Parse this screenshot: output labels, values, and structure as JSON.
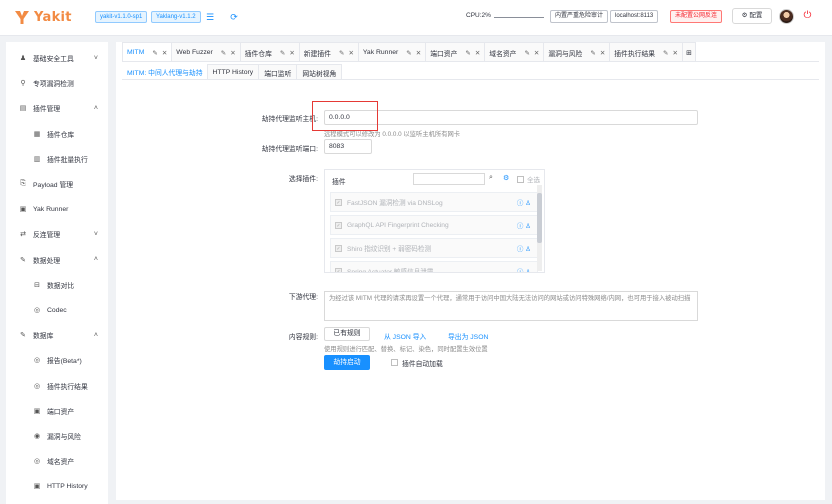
{
  "app": {
    "name": "Yakit",
    "brand_color": "#f28b44",
    "accent": "#1890ff"
  },
  "topbar": {
    "version_tags": [
      "yakit-v1.1.0-sp1",
      "Yaklang-v1.1.2"
    ],
    "icons": [
      "list-icon",
      "refresh-icon"
    ],
    "cpu_label": "CPU:2%",
    "engine_mode": "内置严重危险审计",
    "host": "localhost:8113",
    "warning": "未配置公网反连",
    "settings_label": "配置",
    "power_icon": "power-icon"
  },
  "sidebar": {
    "items": [
      {
        "label": "基础安全工具",
        "icon": "tools-icon",
        "chevron": "⌄",
        "sub": false
      },
      {
        "label": "专项漏洞检测",
        "icon": "scan-icon",
        "chevron": "",
        "sub": false
      },
      {
        "label": "插件管理",
        "icon": "plugin-icon",
        "chevron": "⌃",
        "sub": false
      },
      {
        "label": "插件仓库",
        "icon": "store-icon",
        "chevron": "",
        "sub": true
      },
      {
        "label": "插件批量执行",
        "icon": "batch-icon",
        "chevron": "",
        "sub": true
      },
      {
        "label": "Payload 管理",
        "icon": "payload-icon",
        "chevron": "",
        "sub": false
      },
      {
        "label": "Yak Runner",
        "icon": "runner-icon",
        "chevron": "",
        "sub": false
      },
      {
        "label": "反连管理",
        "icon": "reverse-icon",
        "chevron": "⌄",
        "sub": false
      },
      {
        "label": "数据处理",
        "icon": "data-icon",
        "chevron": "⌃",
        "sub": false
      },
      {
        "label": "数据对比",
        "icon": "compare-icon",
        "chevron": "",
        "sub": true
      },
      {
        "label": "Codec",
        "icon": "codec-icon",
        "chevron": "",
        "sub": true
      },
      {
        "label": "数据库",
        "icon": "database-icon",
        "chevron": "⌃",
        "sub": false
      },
      {
        "label": "报告(Beta*)",
        "icon": "report-icon",
        "chevron": "",
        "sub": true
      },
      {
        "label": "插件执行结果",
        "icon": "result-icon",
        "chevron": "",
        "sub": true
      },
      {
        "label": "端口资产",
        "icon": "port-icon",
        "chevron": "",
        "sub": true
      },
      {
        "label": "漏洞与风险",
        "icon": "risk-icon",
        "chevron": "",
        "sub": true
      },
      {
        "label": "域名资产",
        "icon": "domain-icon",
        "chevron": "",
        "sub": true
      },
      {
        "label": "HTTP History",
        "icon": "history-icon",
        "chevron": "",
        "sub": true
      }
    ]
  },
  "tabs": [
    {
      "label": "MITM",
      "active": true
    },
    {
      "label": "Web Fuzzer",
      "active": false
    },
    {
      "label": "插件仓库",
      "active": false
    },
    {
      "label": "新建插件",
      "active": false
    },
    {
      "label": "Yak Runner",
      "active": false
    },
    {
      "label": "端口资产",
      "active": false
    },
    {
      "label": "域名资产",
      "active": false
    },
    {
      "label": "漏洞与风险",
      "active": false
    },
    {
      "label": "插件执行结果",
      "active": false
    }
  ],
  "subtabs": [
    {
      "label": "MITM: 中间人代理与劫持",
      "active": true
    },
    {
      "label": "HTTP History",
      "active": false
    },
    {
      "label": "端口监听",
      "active": false
    },
    {
      "label": "网站树视角",
      "active": false
    }
  ],
  "form": {
    "host_label": "劫持代理监听主机:",
    "host_value": "0.0.0.0",
    "host_helper": "远程模式可以修改为 0.0.0.0 以监听主机所有网卡",
    "port_label": "劫持代理监听端口:",
    "port_value": "8083",
    "plugins_label": "选择插件:",
    "plugins_header": "插件",
    "select_all": "全选",
    "plugins": [
      "FastJSON 漏洞检测 via DNSLog",
      "GraphQL API Fingerprint Checking",
      "Shiro 指纹识别 + 弱密码检测",
      "Spring Actuator 敏感信息泄露"
    ],
    "downstream_label": "下游代理:",
    "downstream_placeholder": "为经过该 MITM 代理的请求再设置一个代理，通常用于访问中国大陆无法访问的网站或访问特殊网络/内网，也可用于接入被动扫描",
    "content_rules_label": "内容规则:",
    "rules_button": "已有规则",
    "import_json": "从 JSON 导入",
    "export_json": "导出为 JSON",
    "rules_helper": "使用规则进行匹配、替换、标记、染色，同时配置生效位置",
    "start_button": "劫持启动",
    "auto_load_label": "插件自动加载"
  }
}
